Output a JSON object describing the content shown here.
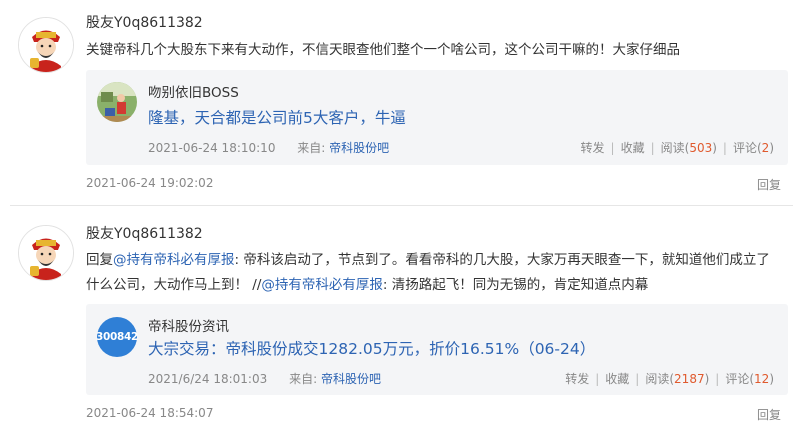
{
  "comments": [
    {
      "username": "股友Y0q8611382",
      "avatar_icon": "caishen-avatar-icon",
      "body": "关键帝科几个大股东下来有大动作，不信天眼查他们整个一个啥公司，这个公司干嘛的！大家仔细品",
      "quote": {
        "author": "吻别依旧BOSS",
        "avatar_icon": "photo-avatar-icon",
        "title": "隆基，天合都是公司前5大客户，牛逼",
        "time": "2021-06-24 18:10:10",
        "source_label": "来自:",
        "source_link": "帝科股份吧",
        "share_label": "转发",
        "fav_label": "收藏",
        "read_label": "阅读",
        "read_count": "503",
        "comment_label": "评论",
        "comment_count": "2"
      },
      "date": "2021-06-24 19:02:02",
      "reply_label": "回复"
    },
    {
      "username": "股友Y0q8611382",
      "avatar_icon": "caishen-avatar-icon",
      "body_parts": {
        "p1": "回复",
        "m1": "@持有帝科必有厚报",
        "p2": ": 帝科该启动了，节点到了。看看帝科的几大股，大家万再天眼查一下，就知道他们成立了什么公司，大动作马上到！ //",
        "m2": "@持有帝科必有厚报",
        "p3": ": 清扬路起飞！同为无锡的，肯定知道点内幕"
      },
      "quote": {
        "author": "帝科股份资讯",
        "badge": "300842",
        "title": "大宗交易：帝科股份成交1282.05万元，折价16.51%（06-24）",
        "time": "2021/6/24 18:01:03",
        "source_label": "来自:",
        "source_link": "帝科股份吧",
        "share_label": "转发",
        "fav_label": "收藏",
        "read_label": "阅读",
        "read_count": "2187",
        "comment_label": "评论",
        "comment_count": "12"
      },
      "date": "2021-06-24 18:54:07",
      "reply_label": "回复"
    }
  ],
  "colors": {
    "link": "#2d64b3",
    "count": "#e05a2e",
    "meta": "#888888",
    "quote_bg": "#f4f5f7",
    "badge_bg": "#2f7fd6"
  }
}
